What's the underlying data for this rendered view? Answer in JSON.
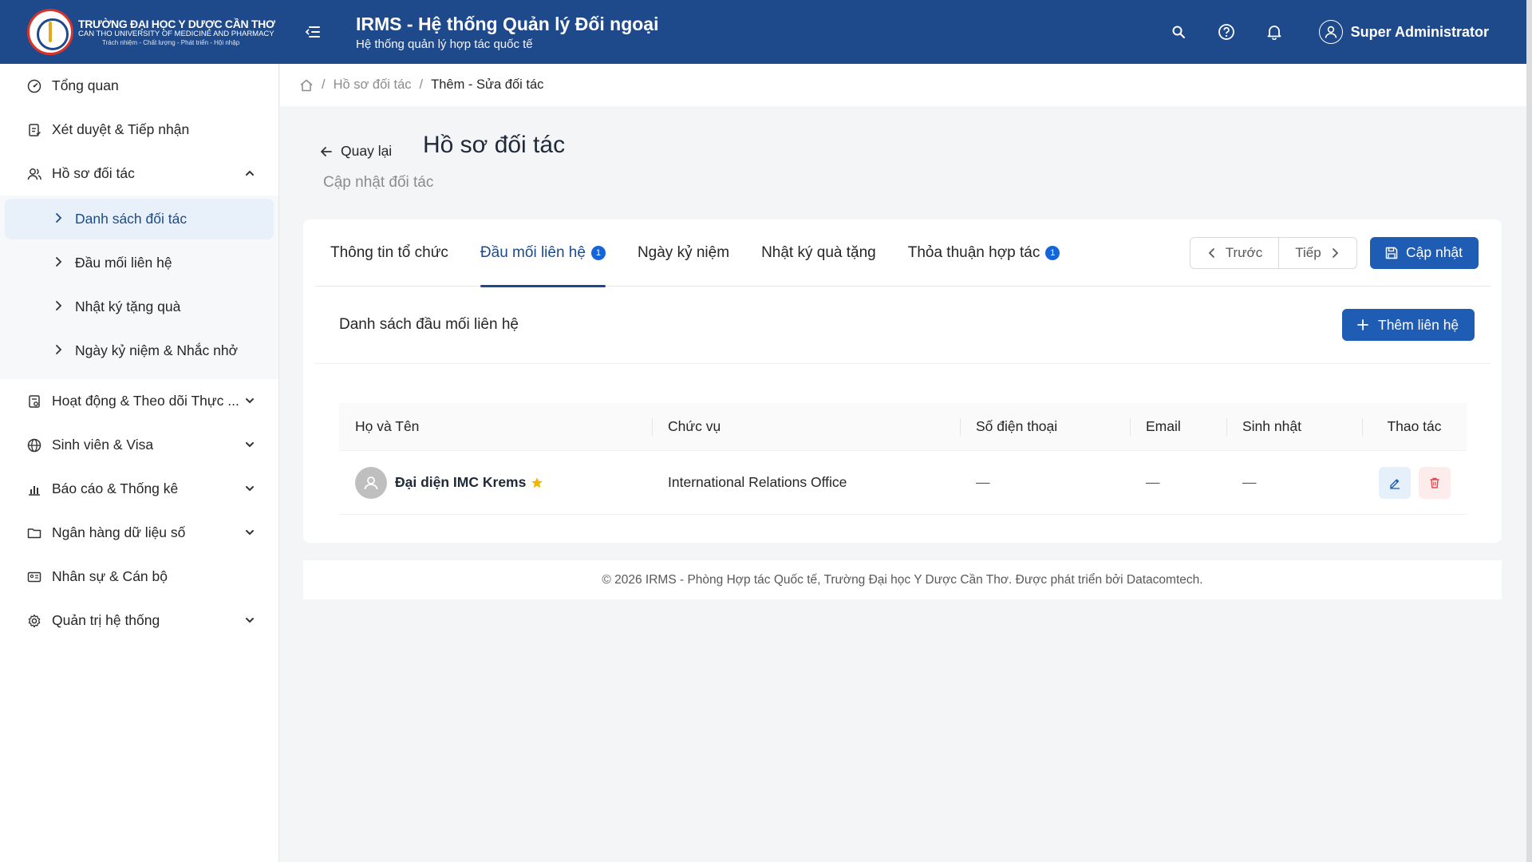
{
  "header": {
    "logo": {
      "line1": "TRƯỜNG ĐẠI HỌC Y DƯỢC CẦN THƠ",
      "line2": "CAN THO UNIVERSITY OF MEDICINE AND PHARMACY",
      "line3": "Trách nhiệm - Chất lượng - Phát triển - Hội nhập"
    },
    "app_title": "IRMS - Hệ thống Quản lý Đối ngoại",
    "app_subtitle": "Hệ thống quản lý hợp tác quốc tế",
    "user_name": "Super Administrator",
    "colors": {
      "header_bg": "#1e4a8c",
      "primary": "#1f5cb3",
      "badge": "#1565d8"
    }
  },
  "sidebar": {
    "items": [
      {
        "label": "Tổng quan",
        "icon": "dashboard-icon"
      },
      {
        "label": "Xét duyệt & Tiếp nhận",
        "icon": "clipboard-icon"
      },
      {
        "label": "Hồ sơ đối tác",
        "icon": "users-icon",
        "expanded": true
      },
      {
        "label": "Hoạt động & Theo dõi Thực ...",
        "icon": "activity-icon"
      },
      {
        "label": "Sinh viên & Visa",
        "icon": "globe-icon"
      },
      {
        "label": "Báo cáo & Thống kê",
        "icon": "bar-chart-icon"
      },
      {
        "label": "Ngân hàng dữ liệu số",
        "icon": "folder-icon"
      },
      {
        "label": "Nhân sự & Cán bộ",
        "icon": "id-card-icon"
      },
      {
        "label": "Quản trị hệ thống",
        "icon": "settings-icon"
      }
    ],
    "submenu": [
      {
        "label": "Danh sách đối tác",
        "active": true
      },
      {
        "label": "Đầu mối liên hệ"
      },
      {
        "label": "Nhật ký tặng quà"
      },
      {
        "label": "Ngày kỷ niệm & Nhắc nhở"
      }
    ]
  },
  "breadcrumb": {
    "items": [
      "Hồ sơ đối tác",
      "Thêm - Sửa đối tác"
    ]
  },
  "page": {
    "back_label": "Quay lại",
    "title": "Hồ sơ đối tác",
    "subtitle": "Cập nhật đối tác"
  },
  "tabs": [
    {
      "label": "Thông tin tổ chức"
    },
    {
      "label": "Đầu mối liên hệ",
      "badge": "1",
      "active": true
    },
    {
      "label": "Ngày kỷ niệm"
    },
    {
      "label": "Nhật ký quà tặng"
    },
    {
      "label": "Thỏa thuận hợp tác",
      "badge": "1"
    }
  ],
  "actions": {
    "prev_label": "Trước",
    "next_label": "Tiếp",
    "update_label": "Cập nhật"
  },
  "contacts": {
    "section_title": "Danh sách đầu mối liên hệ",
    "add_label": "Thêm liên hệ",
    "columns": [
      "Họ và Tên",
      "Chức vụ",
      "Số điện thoại",
      "Email",
      "Sinh nhật",
      "Thao tác"
    ],
    "rows": [
      {
        "name": "Đại diện IMC Krems",
        "position": "International Relations Office",
        "phone": "—",
        "email": "—",
        "birthday": "—",
        "primary": true
      }
    ]
  },
  "footer": {
    "text": "© 2026 IRMS - Phòng Hợp tác Quốc tế, Trường Đại học Y Dược Cần Thơ. Được phát triển bởi Datacomtech."
  }
}
